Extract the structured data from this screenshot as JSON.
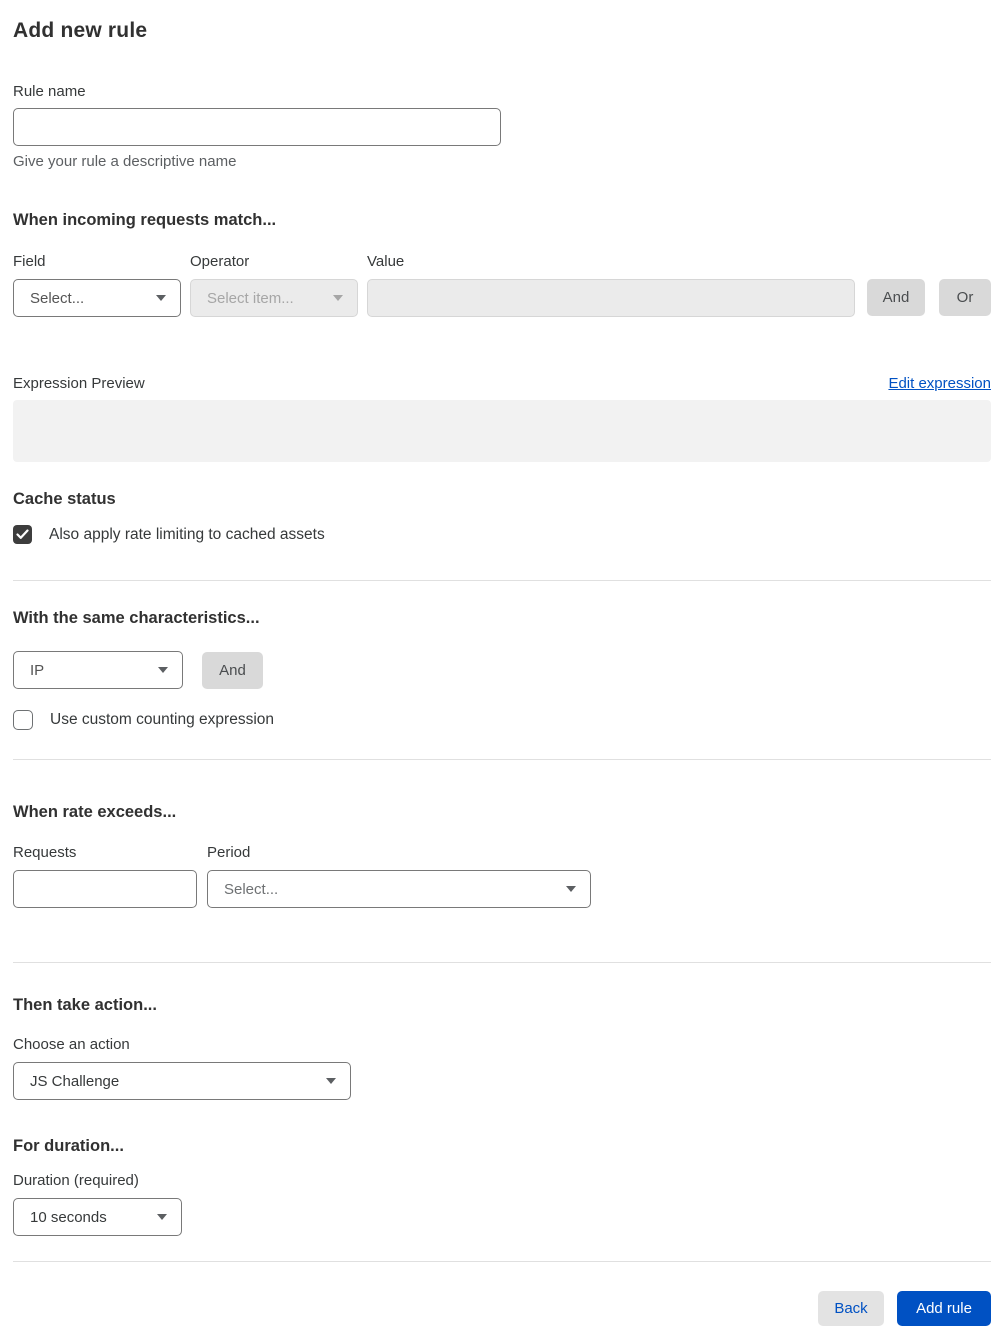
{
  "page": {
    "title": "Add new rule"
  },
  "colors": {
    "accent_blue": "#0051c3",
    "checkbox_checked": "#3d3d3d",
    "disabled_bg": "#ebebeb",
    "preview_bg": "#f2f2f2",
    "gray_button_bg": "#d9d9d9"
  },
  "rule_name": {
    "label": "Rule name",
    "value": "",
    "helper": "Give your rule a descriptive name"
  },
  "match": {
    "heading": "When incoming requests match...",
    "field": {
      "label": "Field",
      "value": "Select..."
    },
    "operator": {
      "label": "Operator",
      "value": "Select item...",
      "disabled": true
    },
    "value_input": {
      "label": "Value",
      "value": "",
      "disabled": true
    },
    "and_label": "And",
    "or_label": "Or"
  },
  "expression": {
    "label": "Expression Preview",
    "edit_link": "Edit expression",
    "preview_text": ""
  },
  "cache": {
    "heading": "Cache status",
    "checkbox_label": "Also apply rate limiting to cached assets",
    "checked": true
  },
  "characteristics": {
    "heading": "With the same characteristics...",
    "select_value": "IP",
    "and_label": "And",
    "checkbox_label": "Use custom counting expression",
    "checked": false
  },
  "rate": {
    "heading": "When rate exceeds...",
    "requests": {
      "label": "Requests",
      "value": ""
    },
    "period": {
      "label": "Period",
      "value": "Select..."
    }
  },
  "action": {
    "heading": "Then take action...",
    "label": "Choose an action",
    "value": "JS Challenge"
  },
  "duration": {
    "heading": "For duration...",
    "label": "Duration (required)",
    "value": "10 seconds"
  },
  "footer": {
    "back_label": "Back",
    "add_label": "Add rule"
  }
}
